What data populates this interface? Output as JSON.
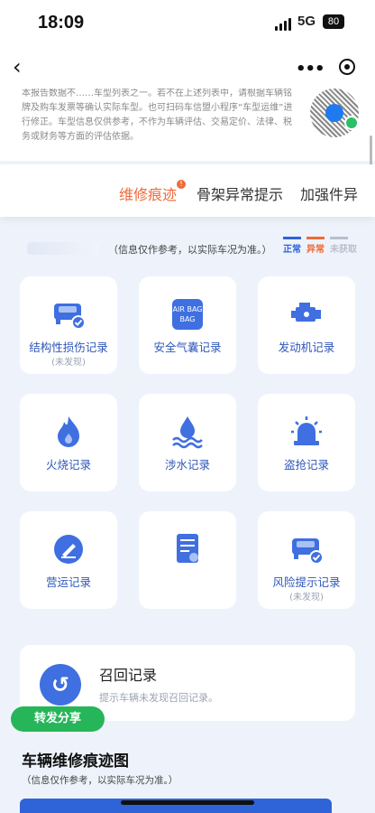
{
  "status": {
    "time": "18:09",
    "network": "5G",
    "battery": "80"
  },
  "disclaimer": {
    "text": "本报告数据不……车型列表之一。若不在上述列表中，请根据车辆铭牌及购车发票等确认实际车型。也可扫码车信盟小程序“车型运维”进行修正。车型信息仅供参考，不作为车辆评估、交易定价、法律、税务或财务等方面的评估依据。"
  },
  "tabs": [
    {
      "label": "维修痕迹",
      "active": true,
      "badge": "!"
    },
    {
      "label": "骨架异常提示",
      "active": false
    },
    {
      "label": "加强件异",
      "active": false
    }
  ],
  "legend": {
    "note": "（信息仅作参考，以实际车况为准。）",
    "items": [
      {
        "label": "正常",
        "color": "#2f63d8"
      },
      {
        "label": "异常",
        "color": "#ef6a3a"
      },
      {
        "label": "未获取",
        "color": "#b8bfcc"
      }
    ]
  },
  "cards": [
    {
      "label": "结构性损伤记录",
      "sub": "(未发现)",
      "icon": "car-damage-icon"
    },
    {
      "label": "安全气囊记录",
      "sub": "",
      "icon": "airbag-icon",
      "icon_text": "AIR BAG"
    },
    {
      "label": "发动机记录",
      "sub": "",
      "icon": "engine-icon"
    },
    {
      "label": "火烧记录",
      "sub": "",
      "icon": "fire-icon"
    },
    {
      "label": "涉水记录",
      "sub": "",
      "icon": "water-icon"
    },
    {
      "label": "盗抢记录",
      "sub": "",
      "icon": "alarm-icon"
    },
    {
      "label": "营运记录",
      "sub": "",
      "icon": "operation-icon"
    },
    {
      "label": "",
      "sub": "",
      "icon": "document-icon"
    },
    {
      "label": "风险提示记录",
      "sub": "(未发现)",
      "icon": "car-risk-icon"
    }
  ],
  "recall": {
    "title": "召回记录",
    "desc": "提示车辆未发现召回记录。",
    "icon": "recall-icon"
  },
  "share": {
    "label": "转发分享"
  },
  "section": {
    "title": "车辆维修痕迹图",
    "note": "（信息仅作参考，以实际车况为准。）"
  },
  "colors": {
    "accent": "#2f63d8",
    "active_tab": "#ef6a3a",
    "share": "#27b55a"
  }
}
